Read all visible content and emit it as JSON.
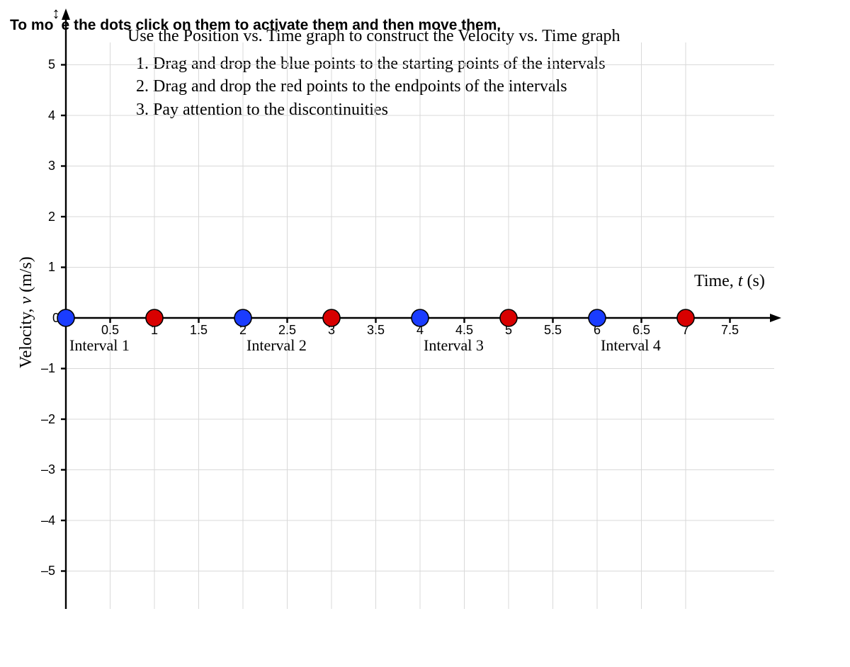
{
  "hint": {
    "prefix": "To mo",
    "arrow": "↕",
    "rest": "e the dots click on them to activate them and then move them."
  },
  "title": "Use the Position vs. Time graph to construct the Velocity vs. Time graph",
  "instructions": "1. Drag and drop the blue points to the starting points of the intervals\n2. Drag and drop the red points to the endpoints of the intervals\n3. Pay attention to the discontinuities",
  "chart_data": {
    "type": "scatter",
    "title": "Use the Position vs. Time graph to construct the Velocity vs. Time graph",
    "xlabel": "Time, t (s)",
    "ylabel": "Velocity, v (m/s)",
    "xlim": [
      0,
      8
    ],
    "ylim": [
      -5,
      5
    ],
    "x_ticks_major": [
      0,
      1,
      2,
      3,
      4,
      5,
      6,
      7
    ],
    "x_ticks_minor": [
      0.5,
      1.5,
      2.5,
      3.5,
      4.5,
      5.5,
      6.5,
      7.5
    ],
    "y_ticks": [
      -5,
      -4,
      -3,
      -2,
      -1,
      0,
      1,
      2,
      3,
      4,
      5
    ],
    "interval_labels": [
      {
        "x": 0.5,
        "text": "Interval 1"
      },
      {
        "x": 2.5,
        "text": "Interval 2"
      },
      {
        "x": 4.5,
        "text": "Interval 3"
      },
      {
        "x": 6.5,
        "text": "Interval 4"
      }
    ],
    "series": [
      {
        "name": "blue-start-points",
        "color": "#1a3cff",
        "points": [
          {
            "x": 0,
            "y": 0
          },
          {
            "x": 2,
            "y": 0
          },
          {
            "x": 4,
            "y": 0
          },
          {
            "x": 6,
            "y": 0
          }
        ]
      },
      {
        "name": "red-end-points",
        "color": "#d80000",
        "points": [
          {
            "x": 1,
            "y": 0
          },
          {
            "x": 3,
            "y": 0
          },
          {
            "x": 5,
            "y": 0
          },
          {
            "x": 7,
            "y": 0
          }
        ]
      }
    ]
  },
  "x_tick_labels": {
    "t0_5": "0.5",
    "t1": "1",
    "t1_5": "1.5",
    "t2": "2",
    "t2_5": "2.5",
    "t3": "3",
    "t3_5": "3.5",
    "t4": "4",
    "t4_5": "4.5",
    "t5": "5",
    "t5_5": "5.5",
    "t6": "6",
    "t6_5": "6.5",
    "t7": "7",
    "t7_5": "7.5"
  },
  "y_tick_labels": {
    "y5": "5",
    "y4": "4",
    "y3": "3",
    "y2": "2",
    "y1": "1",
    "y0": "0",
    "ym1": "–1",
    "ym2": "–2",
    "ym3": "–3",
    "ym4": "–4",
    "ym5": "–5"
  },
  "labels": {
    "xlabel_a": "Time,",
    "xlabel_b": " t ",
    "xlabel_c": "(s)",
    "ylabel_a": "Velocity,",
    "ylabel_b": " v ",
    "ylabel_c": "(m/s)",
    "interval1": "Interval 1",
    "interval2": "Interval 2",
    "interval3": "Interval 3",
    "interval4": "Interval 4"
  }
}
